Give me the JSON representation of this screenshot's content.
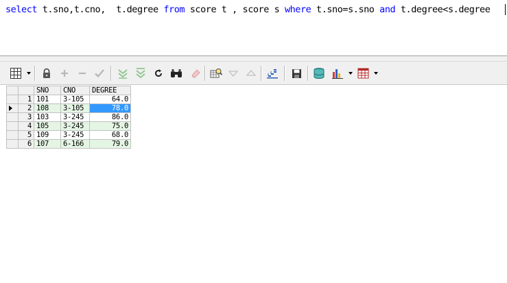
{
  "editor": {
    "sql_tokens": [
      {
        "text": "select",
        "kw": true
      },
      {
        "text": " t.sno,t.cno,  t.degree ",
        "kw": false
      },
      {
        "text": "from",
        "kw": true
      },
      {
        "text": " score t , score s ",
        "kw": false
      },
      {
        "text": "where",
        "kw": true
      },
      {
        "text": " t.sno=s.sno ",
        "kw": false
      },
      {
        "text": "and",
        "kw": true
      },
      {
        "text": " t.degree<s.degree",
        "kw": false
      }
    ]
  },
  "toolbar": {
    "icons": [
      "grid-layout-icon",
      "lock-icon",
      "add-record-icon",
      "delete-record-icon",
      "post-edit-icon",
      "filter-down-icon",
      "filter-clear-icon",
      "refresh-icon",
      "find-icon",
      "clear-icon",
      "query-by-example-icon",
      "next-icon",
      "previous-icon",
      "explain-plan-icon",
      "save-icon",
      "export-db-icon",
      "chart-icon",
      "table-export-icon"
    ]
  },
  "grid": {
    "columns": [
      "SNO",
      "CNO",
      "DEGREE"
    ],
    "selected_row": 2,
    "rows": [
      {
        "num": "1",
        "sno": "101",
        "cno": "3-105",
        "degree": "64.0"
      },
      {
        "num": "2",
        "sno": "108",
        "cno": "3-105",
        "degree": "78.0"
      },
      {
        "num": "3",
        "sno": "103",
        "cno": "3-245",
        "degree": "86.0"
      },
      {
        "num": "4",
        "sno": "105",
        "cno": "3-245",
        "degree": "75.0"
      },
      {
        "num": "5",
        "sno": "109",
        "cno": "3-245",
        "degree": "68.0"
      },
      {
        "num": "6",
        "sno": "107",
        "cno": "6-166",
        "degree": "79.0"
      }
    ]
  },
  "colors": {
    "keyword": "#0000ff",
    "alt_row": "#e4f5e4",
    "selection": "#3399ff"
  }
}
